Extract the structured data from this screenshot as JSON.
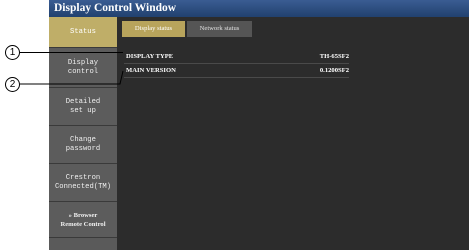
{
  "window": {
    "title": "Display Control Window"
  },
  "sidebar": {
    "items": [
      {
        "label": "Status"
      },
      {
        "label": "Display\ncontrol"
      },
      {
        "label": "Detailed\nset up"
      },
      {
        "label": "Change\npassword"
      },
      {
        "label": "Crestron\nConnected(TM)"
      },
      {
        "label": "» Browser\nRemote Control"
      }
    ]
  },
  "tabs": [
    {
      "label": "Display status"
    },
    {
      "label": "Network status"
    }
  ],
  "status_rows": [
    {
      "label": "DISPLAY TYPE",
      "value": "TH-65SF2"
    },
    {
      "label": "MAIN VERSION",
      "value": "0.1200SF2"
    }
  ],
  "callouts": [
    "1",
    "2"
  ],
  "colors": {
    "title_bar": "#2b4d82",
    "active_item": "#bfae68",
    "sidebar": "#5c5c5c",
    "content_bg": "#2c2c2c"
  }
}
